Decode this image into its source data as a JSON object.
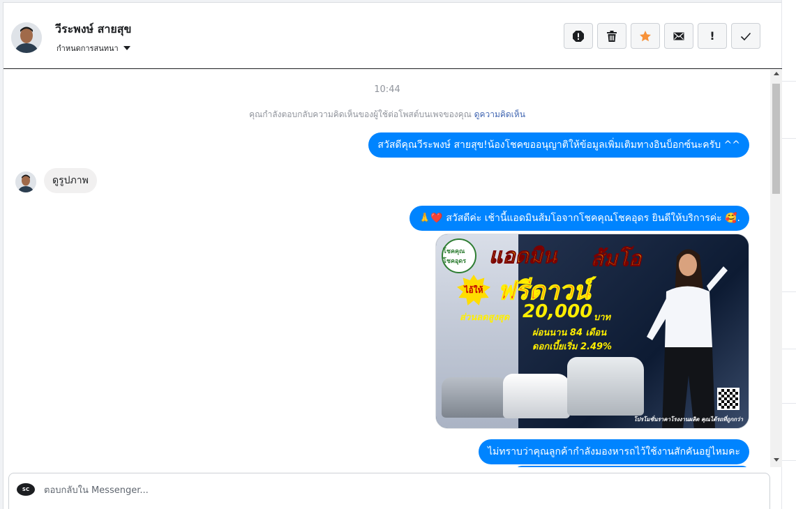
{
  "header": {
    "contact_name": "วีระพงษ์ สายสุข",
    "assign_label": "กำหนดการสนทนา",
    "buttons": [
      {
        "name": "spam-button",
        "icon": "report-icon"
      },
      {
        "name": "delete-button",
        "icon": "trash-icon"
      },
      {
        "name": "follow-up-button",
        "icon": "star-icon",
        "color": "#f7923a"
      },
      {
        "name": "mark-unread-button",
        "icon": "envelope-icon"
      },
      {
        "name": "priority-button",
        "icon": "exclamation-icon",
        "glyph": "!"
      },
      {
        "name": "mark-done-button",
        "icon": "check-icon"
      }
    ]
  },
  "thread": {
    "timestamp": "10:44",
    "context_text": "คุณกำลังตอบกลับความคิดเห็นของผู้ใช้ต่อโพสต์บนเพจของคุณ",
    "context_link": "ดูความคิดเห็น",
    "messages": [
      {
        "direction": "out",
        "text": "สวัสดีคุณวีระพงษ์ สายสุข!น้องโชคขออนุญาติให้ข้อมูลเพิ่มเติมทางอินบ็อกซ์นะครับ ^^"
      },
      {
        "direction": "in",
        "text": "ดูรูปภาพ"
      },
      {
        "direction": "out",
        "emoji_prefix": "🙏❤️",
        "text": "สวัสดีค่ะ เช้านี้แอดมินส้มโอจากโชคคุณโชคอุดร ยินดีให้บริการค่ะ",
        "emoji_suffix": "🥰",
        "tail": "."
      },
      {
        "direction": "out",
        "text": "ไม่ทราบว่าคุณลูกค้ากำลังมองหารถไว้ใช้งานสักคันอยู่ไหมคะ"
      }
    ],
    "promo_image": {
      "headline_1": "แอดมิน",
      "headline_2": "ส้มโอ",
      "badge": "ไอ้ให้",
      "free_down": "ฟรีดาวน์",
      "discount_label": "ส่วนลดสูงสุด",
      "discount_value": "20,000",
      "discount_unit": "บาท",
      "installment": "ผ่อนนาน 84 เดือน",
      "interest": "ดอกเบี้ยเริ่ม 2.49%",
      "footer": "โปรโมชั่นราคาโรงงานผลิต คุณได้รถที่ถูกกว่า",
      "logo_text": "โชคคุณโชคอุดร"
    }
  },
  "composer": {
    "placeholder": "ตอบกลับใน Messenger...",
    "page_logo_text": "SC"
  },
  "colors": {
    "bubble_out": "#0084ff",
    "bubble_in": "#f1f0f0",
    "star": "#f7923a"
  }
}
